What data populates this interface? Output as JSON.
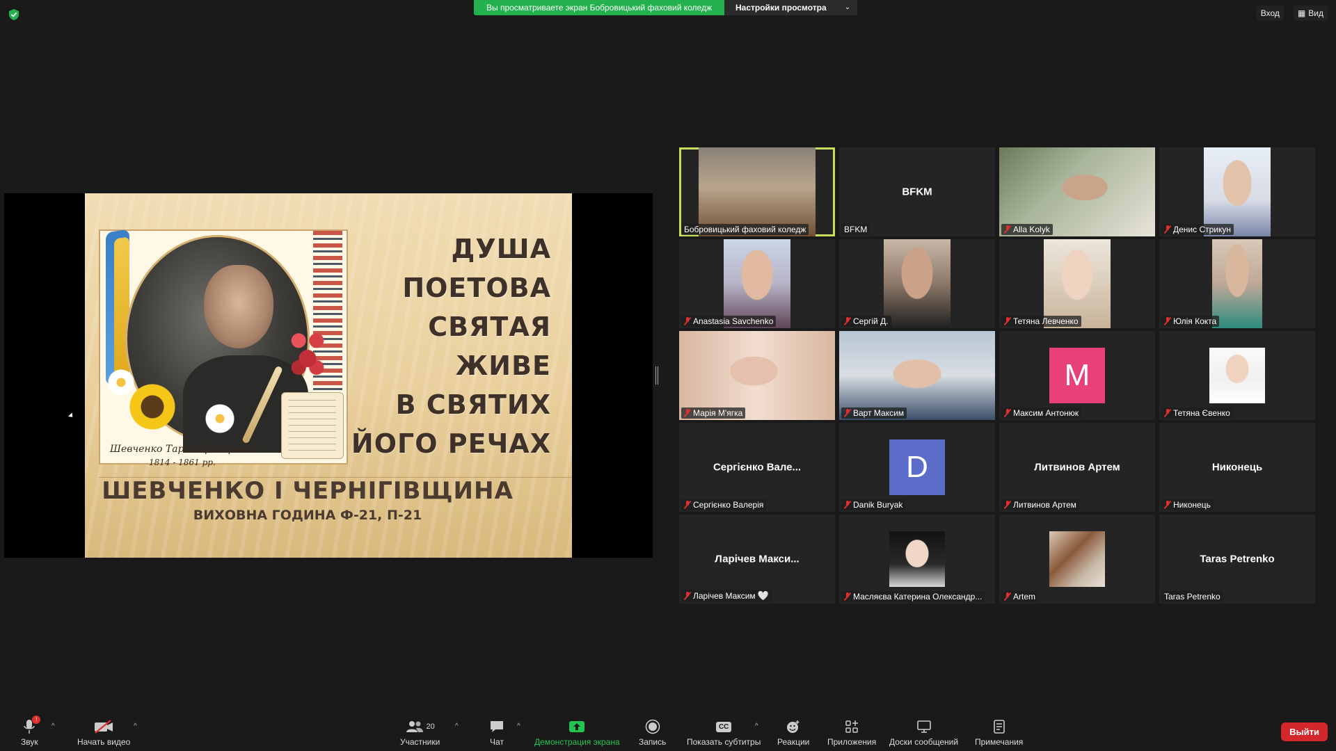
{
  "banner": {
    "message": "Вы просматриваете экран Бобровицький фаховий коледж",
    "options_label": "Настройки просмотра"
  },
  "top_right": {
    "signin": "Вход",
    "view": "Вид"
  },
  "slide": {
    "lines": [
      "ДУША",
      "ПОЕТОВА",
      "СВЯТАЯ",
      "ЖИВЕ",
      "В СВЯТИХ",
      "ЙОГО РЕЧАХ"
    ],
    "title": "ШЕВЧЕНКО І ЧЕРНІГІВЩИНА",
    "subtitle": "ВИХОВНА ГОДИНА Ф-21, П-21",
    "signature": "Шевченко Тарас Григорович",
    "years": "1814 - 1861 рр."
  },
  "participants": [
    {
      "label": "Бобровицький фаховий коледж",
      "muted": false,
      "type": "video",
      "active": true
    },
    {
      "label": "BFKM",
      "muted": false,
      "type": "name",
      "center": "BFKM"
    },
    {
      "label": "Alla Kolyk",
      "muted": true,
      "type": "video-full"
    },
    {
      "label": "Денис Стрикун",
      "muted": true,
      "type": "video"
    },
    {
      "label": "Anastasia Savchenko",
      "muted": true,
      "type": "video"
    },
    {
      "label": "Сергій Д.",
      "muted": true,
      "type": "video"
    },
    {
      "label": "Тетяна Левченко",
      "muted": true,
      "type": "video"
    },
    {
      "label": "Юлія Кокта",
      "muted": true,
      "type": "video"
    },
    {
      "label": "Марія М'ягка",
      "muted": true,
      "type": "video-full"
    },
    {
      "label": "Варт Максим",
      "muted": true,
      "type": "video-full"
    },
    {
      "label": "Максим Антонюк",
      "muted": true,
      "type": "avatar",
      "letter": "M",
      "color": "#e8407a"
    },
    {
      "label": "Тетяна Євенко",
      "muted": true,
      "type": "photo"
    },
    {
      "label": "Сергієнко Валерія",
      "muted": true,
      "type": "name",
      "center": "Сергієнко Вале..."
    },
    {
      "label": "Danik Buryak",
      "muted": true,
      "type": "avatar",
      "letter": "D",
      "color": "#5b6bc8"
    },
    {
      "label": "Литвинов Артем",
      "muted": true,
      "type": "name",
      "center": "Литвинов Артем"
    },
    {
      "label": "Никонець",
      "muted": true,
      "type": "name",
      "center": "Никонець"
    },
    {
      "label": "Ларічев Максим",
      "muted": true,
      "type": "name",
      "center": "Ларічев Макси...",
      "heart": "🤍"
    },
    {
      "label": "Масляєва Катерина Олександр...",
      "muted": true,
      "type": "photo"
    },
    {
      "label": "Artem",
      "muted": true,
      "type": "photo"
    },
    {
      "label": "Taras Petrenko",
      "muted": false,
      "type": "name",
      "center": "Taras Petrenko"
    }
  ],
  "toolbar": {
    "audio": "Звук",
    "audio_badge": "!",
    "video": "Начать видео",
    "participants": "Участники",
    "participants_count": "20",
    "chat": "Чат",
    "share": "Демонстрация экрана",
    "record": "Запись",
    "captions": "Показать субтитры",
    "captions_icon": "CC",
    "reactions": "Реакции",
    "apps": "Приложения",
    "whiteboards": "Доски сообщений",
    "notes": "Примечания",
    "leave": "Выйти"
  },
  "colors": {
    "accent_green": "#23b14d",
    "active_border": "#c6e05a",
    "leave_red": "#d4272b"
  }
}
